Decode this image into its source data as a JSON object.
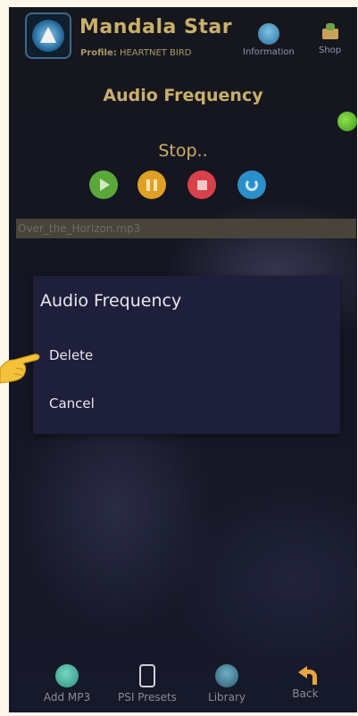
{
  "app": {
    "title": "Mandala Star",
    "profile_label": "Profile:",
    "profile_name": "HEARTNET BIRD"
  },
  "header_buttons": {
    "information": {
      "label": "Information",
      "icon": "information-icon"
    },
    "shop": {
      "label": "Shop",
      "icon": "shop-cart-icon"
    }
  },
  "player": {
    "section_title": "Audio Frequency",
    "status": "Stop..",
    "status_indicator_color": "#5fbf2e",
    "controls": [
      {
        "name": "play",
        "icon": "play-icon",
        "color": "#5aa83a"
      },
      {
        "name": "pause",
        "icon": "pause-icon",
        "color": "#e0a024"
      },
      {
        "name": "stop",
        "icon": "stop-icon",
        "color": "#d9414a"
      },
      {
        "name": "replay",
        "icon": "replay-icon",
        "color": "#2b8fc9"
      }
    ],
    "selected_file": "Over_the_Horizon.mp3"
  },
  "dialog": {
    "title": "Audio Frequency",
    "options": {
      "delete": "Delete",
      "cancel": "Cancel"
    }
  },
  "bottom_nav": {
    "add_mp3": "Add MP3",
    "psi_presets": "PSI Presets",
    "library": "Library",
    "back": "Back"
  }
}
